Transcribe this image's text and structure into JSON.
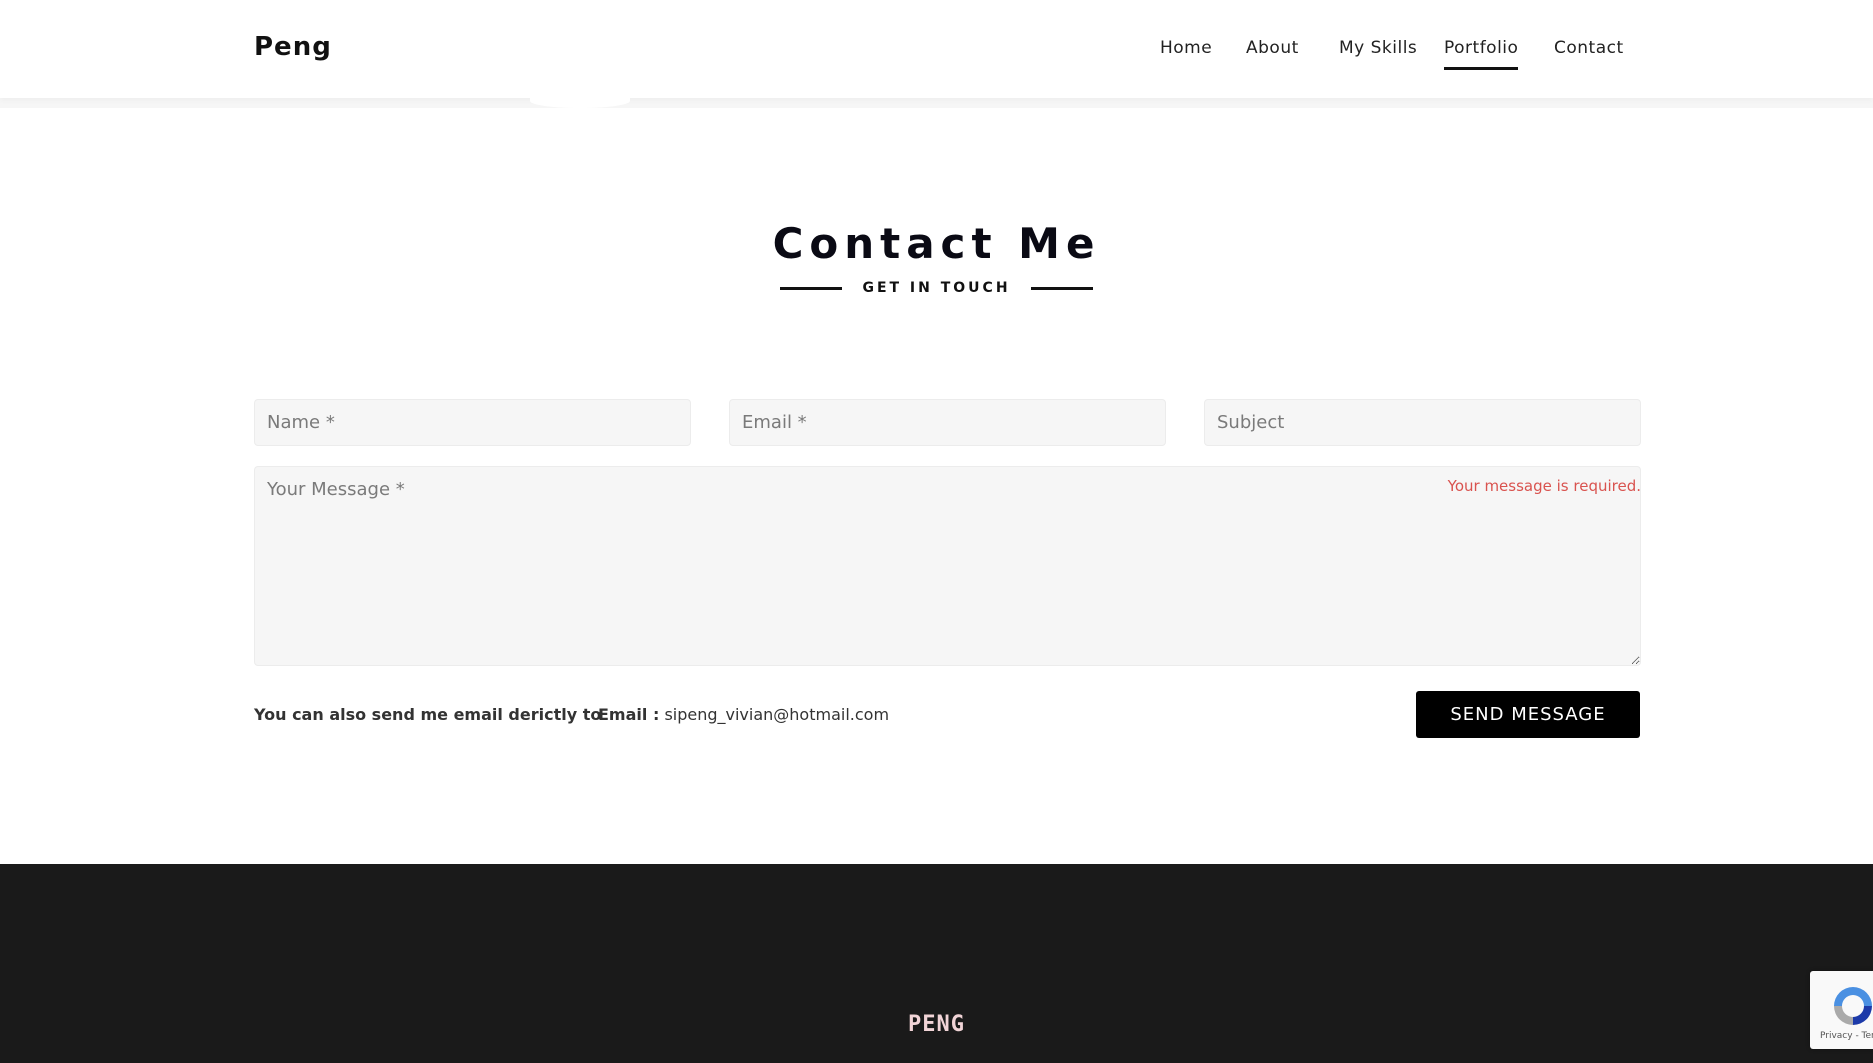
{
  "header": {
    "logo": "Peng",
    "nav": [
      "Home",
      "About",
      "My Skills",
      "Portfolio",
      "Contact"
    ],
    "active_nav": "Portfolio"
  },
  "section": {
    "title": "Contact Me",
    "subtitle": "GET IN TOUCH"
  },
  "form": {
    "name_placeholder": "Name *",
    "email_placeholder": "Email *",
    "subject_placeholder": "Subject",
    "message_placeholder": "Your Message *",
    "message_error": "Your message is required.",
    "also_text": "You can also send me email derictly to",
    "email_label": "Email :",
    "email_value": "sipeng_vivian@hotmail.com",
    "send_label": "SEND MESSAGE"
  },
  "footer": {
    "logo": "PENG"
  },
  "recaptcha": {
    "text": "Privacy - Terms",
    "icon": "recaptcha-icon"
  },
  "colors": {
    "footer_bg": "#1a1a1a",
    "error": "#d9534f",
    "button_bg": "#000000"
  }
}
